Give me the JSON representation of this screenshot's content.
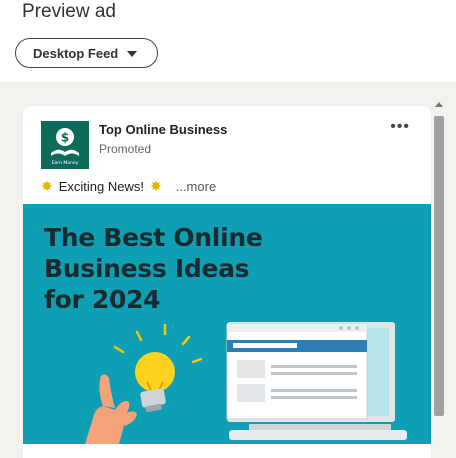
{
  "header": {
    "title": "Preview ad"
  },
  "dropdown": {
    "selected": "Desktop Feed"
  },
  "post": {
    "company": "Top Online Business",
    "status": "Promoted",
    "text": "Exciting News!",
    "more": "...more",
    "options_icon": "more-horizontal-icon"
  },
  "logo": {
    "text": "Earn Money"
  },
  "ad_image": {
    "headline": [
      "The Best Online",
      "Business Ideas",
      "for 2024"
    ]
  },
  "colors": {
    "brand_green": "#0e6b5b",
    "ad_background": "#0f9fb4",
    "panel_background": "#f3f2ef"
  }
}
